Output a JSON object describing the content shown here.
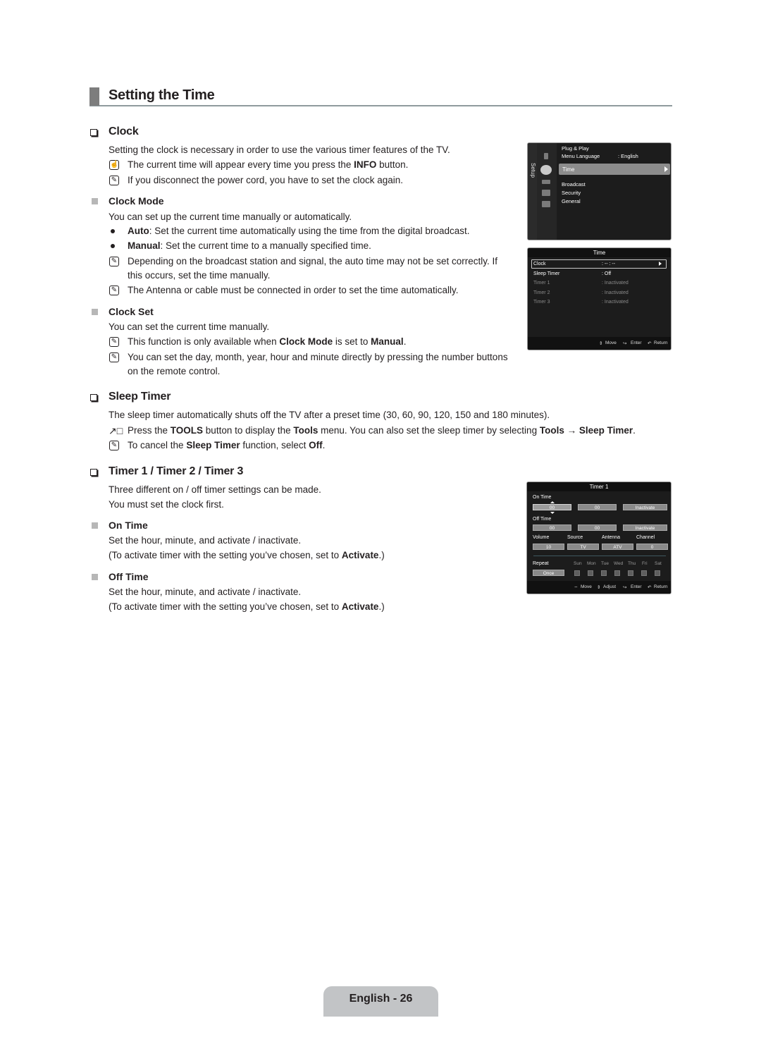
{
  "page": {
    "section_title": "Setting the Time",
    "footer_label": "English - 26"
  },
  "clock": {
    "heading": "Clock",
    "intro": "Setting the clock is necessary in order to use the various timer features of the TV.",
    "info_note_pre": "The current time will appear every time you press the ",
    "info_note_bold": "INFO",
    "info_note_post": " button.",
    "power_note": "If you disconnect the power cord, you have to set the clock again.",
    "clock_mode": {
      "heading": "Clock Mode",
      "intro": "You can set up the current time manually or automatically.",
      "auto_bold": "Auto",
      "auto_text": ": Set the current time automatically using the time from the digital broadcast.",
      "manual_bold": "Manual",
      "manual_text": ": Set the current time to a manually specified time.",
      "note1_line1": "Depending on the broadcast station and signal, the auto time may not be set correctly. If",
      "note1_line2": "this occurs, set the time manually.",
      "note2": "The Antenna or cable must be connected in order to set the time automatically."
    },
    "clock_set": {
      "heading": "Clock Set",
      "intro": "You can set the current time manually.",
      "note1_pre": "This function is only available when ",
      "note1_bold1": "Clock Mode",
      "note1_mid": " is set to ",
      "note1_bold2": "Manual",
      "note1_post": ".",
      "note2_line1": "You can set the day, month, year, hour and minute directly by pressing the number buttons",
      "note2_line2": "on the remote control."
    }
  },
  "sleep_timer": {
    "heading": "Sleep Timer",
    "intro": "The sleep timer automatically shuts off the TV after a preset time (30, 60, 90, 120, 150 and 180 minutes).",
    "tools_pre": "Press the ",
    "tools_b1": "TOOLS",
    "tools_mid1": " button to display the ",
    "tools_b2": "Tools",
    "tools_mid2": " menu. You can also set the sleep timer by selecting ",
    "tools_b3": "Tools → Sleep Timer",
    "tools_post": ".",
    "cancel_pre": "To cancel the ",
    "cancel_b1": "Sleep Timer",
    "cancel_mid": " function, select ",
    "cancel_b2": "Off",
    "cancel_post": "."
  },
  "timers": {
    "heading": "Timer 1 / Timer 2 / Timer 3",
    "intro1": "Three different on / off timer settings can be made.",
    "intro2": "You must set the clock first.",
    "on_time": {
      "heading": "On Time",
      "text": "Set the hour, minute, and activate / inactivate.",
      "note_pre": "(To activate timer with the setting you’ve chosen, set to ",
      "note_bold": "Activate",
      "note_post": ".)"
    },
    "off_time": {
      "heading": "Off Time",
      "text": "Set the hour, minute, and activate / inactivate.",
      "note_pre": "(To activate timer with the setting you’ve chosen, set to ",
      "note_bold": "Activate",
      "note_post": ".)"
    }
  },
  "osd_setup": {
    "side_label": "Setup",
    "items": [
      "Plug & Play",
      "Menu Language",
      "Time",
      "Broadcast",
      "Security",
      "General"
    ],
    "menu_language_value": ": English",
    "selected": "Time"
  },
  "osd_time": {
    "title": "Time",
    "rows": [
      {
        "label": "Clock",
        "value": ": -- : --"
      },
      {
        "label": "Sleep Timer",
        "value": ": Off"
      },
      {
        "label": "Timer 1",
        "value": ": Inactivated"
      },
      {
        "label": "Timer 2",
        "value": ": Inactivated"
      },
      {
        "label": "Timer 3",
        "value": ": Inactivated"
      }
    ],
    "footer": {
      "move": "Move",
      "enter": "Enter",
      "return": "Return"
    }
  },
  "osd_timer1": {
    "title": "Timer 1",
    "on_time_label": "On Time",
    "on_hour": "00",
    "on_minute": "00",
    "on_state": "Inactivate",
    "off_time_label": "Off Time",
    "off_hour": "00",
    "off_minute": "00",
    "off_state": "Inactivate",
    "volume_label": "Volume",
    "volume_value": "10",
    "source_label": "Source",
    "source_value": "TV",
    "antenna_label": "Antenna",
    "antenna_value": "ATV",
    "channel_label": "Channel",
    "channel_value": "0",
    "repeat_label": "Repeat",
    "repeat_value": "Once",
    "days": [
      "Sun",
      "Mon",
      "Tue",
      "Wed",
      "Thu",
      "Fri",
      "Sat"
    ],
    "footer": {
      "move": "Move",
      "adjust": "Adjust",
      "enter": "Enter",
      "return": "Return"
    }
  }
}
